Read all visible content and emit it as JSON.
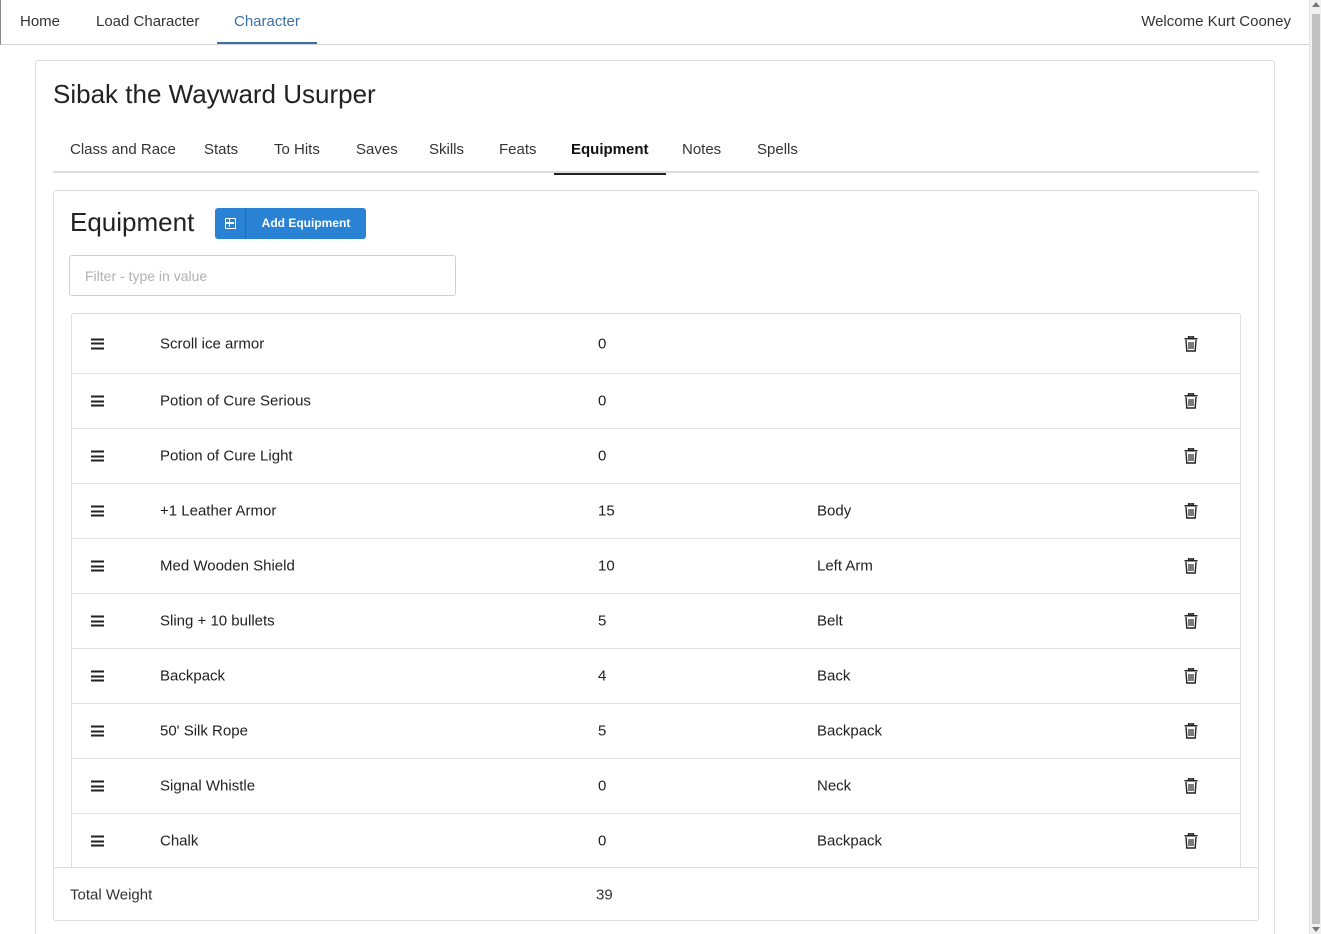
{
  "nav": {
    "links": [
      "Home",
      "Load Character",
      "Character"
    ],
    "active": "Character",
    "welcome": "Welcome Kurt Cooney"
  },
  "character": {
    "name": "Sibak the Wayward Usurper"
  },
  "tabs": [
    "Class and Race",
    "Stats",
    "To Hits",
    "Saves",
    "Skills",
    "Feats",
    "Equipment",
    "Notes",
    "Spells"
  ],
  "active_tab": "Equipment",
  "equipment": {
    "title": "Equipment",
    "add_button_label": "Add Equipment",
    "filter_placeholder": "Filter - type in value",
    "items": [
      {
        "name": "Scroll ice armor",
        "weight": "0",
        "location": ""
      },
      {
        "name": "Potion of Cure Serious",
        "weight": "0",
        "location": ""
      },
      {
        "name": "Potion of Cure Light",
        "weight": "0",
        "location": ""
      },
      {
        "name": "+1 Leather Armor",
        "weight": "15",
        "location": "Body"
      },
      {
        "name": "Med Wooden Shield",
        "weight": "10",
        "location": "Left Arm"
      },
      {
        "name": "Sling + 10 bullets",
        "weight": "5",
        "location": "Belt"
      },
      {
        "name": "Backpack",
        "weight": "4",
        "location": "Back"
      },
      {
        "name": "50' Silk Rope",
        "weight": "5",
        "location": "Backpack"
      },
      {
        "name": "Signal Whistle",
        "weight": "0",
        "location": "Neck"
      },
      {
        "name": "Chalk",
        "weight": "0",
        "location": "Backpack"
      }
    ],
    "total_label": "Total Weight",
    "total_value": "39"
  },
  "colors": {
    "accent": "#3b6fa6",
    "button": "#2a82d4"
  },
  "icons": {
    "row_handle": "hamburger-icon",
    "row_delete": "trash-icon",
    "add": "plus-square-icon"
  }
}
